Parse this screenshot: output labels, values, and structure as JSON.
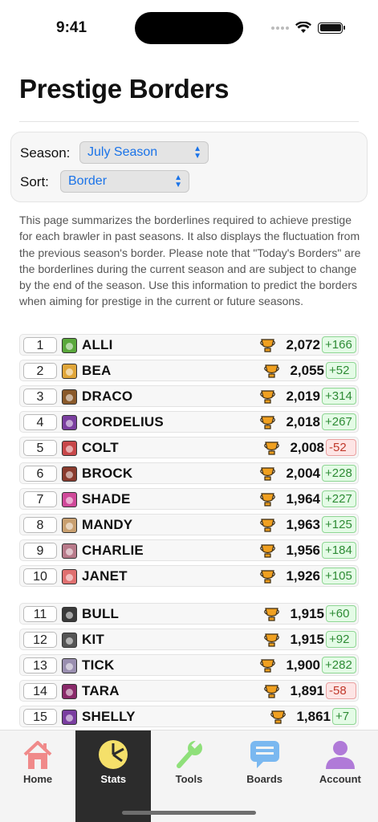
{
  "status_bar": {
    "time": "9:41"
  },
  "page": {
    "title": "Prestige Borders"
  },
  "controls": {
    "season_label": "Season:",
    "season_value": "July Season",
    "sort_label": "Sort:",
    "sort_value": "Border"
  },
  "intro": "This page summarizes the borderlines required to achieve prestige for each brawler in past seasons. It also displays the fluctuation from the previous season's border. Please note that \"Today's Borders\" are the borderlines during the current season and are subject to change by the end of the season. Use this information to predict the borders when aiming for prestige in the current or future seasons.",
  "brawlers": [
    {
      "rank": "1",
      "name": "ALLI",
      "score": "2,072",
      "delta": "+166",
      "trend": "up",
      "color": "#5aa83c"
    },
    {
      "rank": "2",
      "name": "BEA",
      "score": "2,055",
      "delta": "+52",
      "trend": "up",
      "color": "#e0a63a"
    },
    {
      "rank": "3",
      "name": "DRACO",
      "score": "2,019",
      "delta": "+314",
      "trend": "up",
      "color": "#8a5a2b"
    },
    {
      "rank": "4",
      "name": "CORDELIUS",
      "score": "2,018",
      "delta": "+267",
      "trend": "up",
      "color": "#7b3fa0"
    },
    {
      "rank": "5",
      "name": "COLT",
      "score": "2,008",
      "delta": "-52",
      "trend": "down",
      "color": "#c8484a"
    },
    {
      "rank": "6",
      "name": "BROCK",
      "score": "2,004",
      "delta": "+228",
      "trend": "up",
      "color": "#8a3b2e"
    },
    {
      "rank": "7",
      "name": "SHADE",
      "score": "1,964",
      "delta": "+227",
      "trend": "up",
      "color": "#d04a9a"
    },
    {
      "rank": "8",
      "name": "MANDY",
      "score": "1,963",
      "delta": "+125",
      "trend": "up",
      "color": "#c9a070"
    },
    {
      "rank": "9",
      "name": "CHARLIE",
      "score": "1,956",
      "delta": "+184",
      "trend": "up",
      "color": "#b87a8a"
    },
    {
      "rank": "10",
      "name": "JANET",
      "score": "1,926",
      "delta": "+105",
      "trend": "up",
      "color": "#e07070"
    },
    {
      "rank": "11",
      "name": "BULL",
      "score": "1,915",
      "delta": "+60",
      "trend": "up",
      "color": "#3a3a3a"
    },
    {
      "rank": "12",
      "name": "KIT",
      "score": "1,915",
      "delta": "+92",
      "trend": "up",
      "color": "#555555"
    },
    {
      "rank": "13",
      "name": "TICK",
      "score": "1,900",
      "delta": "+282",
      "trend": "up",
      "color": "#9a8fb0"
    },
    {
      "rank": "14",
      "name": "TARA",
      "score": "1,891",
      "delta": "-58",
      "trend": "down",
      "color": "#8a2a6a"
    },
    {
      "rank": "15",
      "name": "SHELLY",
      "score": "1,861",
      "delta": "+7",
      "trend": "up",
      "color": "#7a3ea0"
    }
  ],
  "tabs": [
    {
      "label": "Home",
      "icon": "house-icon",
      "color": "#f08a8a"
    },
    {
      "label": "Stats",
      "icon": "pie-chart-icon",
      "color": "#f5e06a",
      "active": true
    },
    {
      "label": "Tools",
      "icon": "wrench-icon",
      "color": "#8fe07a"
    },
    {
      "label": "Boards",
      "icon": "chat-bubble-icon",
      "color": "#7ab8f0"
    },
    {
      "label": "Account",
      "icon": "person-icon",
      "color": "#b07ad8"
    }
  ]
}
